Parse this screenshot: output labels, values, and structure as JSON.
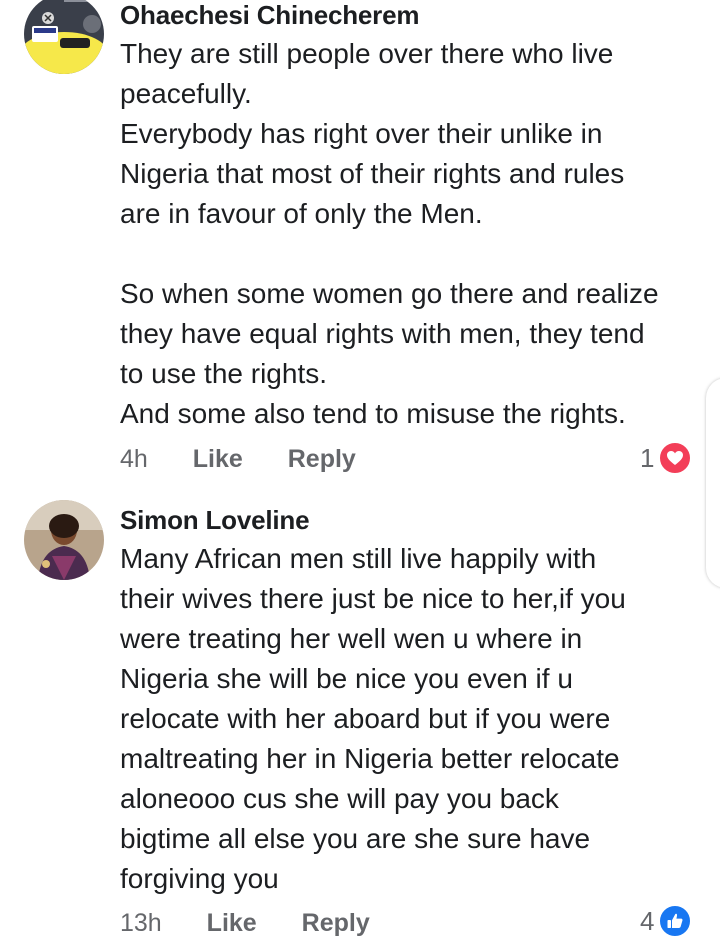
{
  "comments": [
    {
      "author": "Ohaechesi Chinecherem",
      "lines": [
        "They are still people over there who live",
        "peacefully.",
        "Everybody has right over their unlike in",
        "Nigeria that most of their rights and rules",
        "are in favour of only the Men.",
        "",
        "So when some women go there and realize",
        "they have equal rights with men, they tend",
        "to use the rights.",
        "And some also tend to misuse the rights."
      ],
      "time": "4h",
      "like_label": "Like",
      "reply_label": "Reply",
      "reaction_count": "1",
      "reaction_icon": "love-heart-icon",
      "reaction_color": "#f33e58"
    },
    {
      "author": "Simon Loveline",
      "lines": [
        "Many African men still live happily with",
        "their wives there just be nice to her,if you",
        "were treating her well wen u where in",
        "Nigeria she will be nice you even if u",
        "relocate with her aboard but if you were",
        "maltreating her in Nigeria better relocate",
        "aloneooo cus  she will pay you back",
        "bigtime all else you are she sure have",
        "forgiving you"
      ],
      "time": "13h",
      "like_label": "Like",
      "reply_label": "Reply",
      "reaction_count": "4",
      "reaction_icon": "thumbs-up-icon",
      "reaction_color": "#1877f2"
    }
  ]
}
